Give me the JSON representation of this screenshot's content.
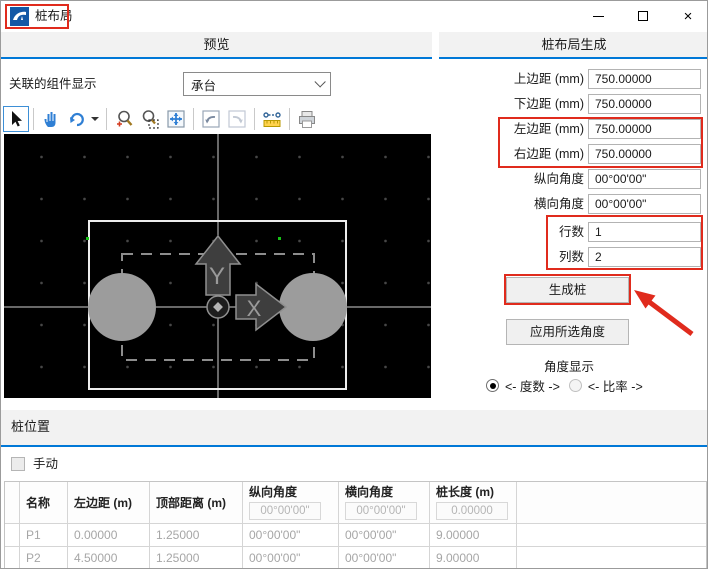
{
  "window": {
    "title": "桩布局",
    "controls": {
      "minimize": "minimize",
      "maximize": "maximize",
      "close_glyph": "×"
    }
  },
  "colors": {
    "accent_blue": "#0078d7",
    "annotation_red": "#e02b1d",
    "pile_gray": "#9c9c9c"
  },
  "preview_panel": {
    "header": "预览",
    "component_label": "关联的组件显示",
    "component_value": "承台",
    "toolbar_icons": [
      "select-cursor",
      "pan-hand",
      "rotate-view",
      "zoom-in",
      "zoom-window",
      "fit-view",
      "prev-view",
      "next-view",
      "measure",
      "print"
    ],
    "canvas": {
      "x_axis_label": "X",
      "y_axis_label": "Y"
    }
  },
  "generation_panel": {
    "header": "桩布局生成",
    "fields": [
      {
        "label": "上边距 (mm)",
        "value": "750.00000"
      },
      {
        "label": "下边距 (mm)",
        "value": "750.00000"
      },
      {
        "label": "左边距 (mm)",
        "value": "750.00000"
      },
      {
        "label": "右边距 (mm)",
        "value": "750.00000"
      },
      {
        "label": "纵向角度",
        "value": "00°00'00\""
      },
      {
        "label": "横向角度",
        "value": "00°00'00\""
      },
      {
        "label": "行数",
        "value": "1"
      },
      {
        "label": "列数",
        "value": "2"
      }
    ],
    "generate_button": "生成桩",
    "apply_angle_button": "应用所选角度",
    "angle_display_label": "角度显示",
    "angle_options": [
      {
        "label": "<- 度数 ->",
        "selected": true
      },
      {
        "label": "<- 比率 ->",
        "selected": false
      }
    ]
  },
  "pile_position_panel": {
    "header": "桩位置",
    "manual_label": "手动",
    "table": {
      "columns": [
        "名称",
        "左边距 (m)",
        "顶部距离 (m)",
        "纵向角度",
        "横向角度",
        "桩长度 (m)"
      ],
      "header_inputs": {
        "vertical_angle": "00°00'00\"",
        "horizontal_angle": "00°00'00\"",
        "pile_length": "0.00000"
      },
      "rows": [
        {
          "name": "P1",
          "left_margin": "0.00000",
          "top_distance": "1.25000",
          "vertical_angle": "00°00'00\"",
          "horizontal_angle": "00°00'00\"",
          "pile_length": "9.00000"
        },
        {
          "name": "P2",
          "left_margin": "4.50000",
          "top_distance": "1.25000",
          "vertical_angle": "00°00'00\"",
          "horizontal_angle": "00°00'00\"",
          "pile_length": "9.00000"
        }
      ]
    }
  }
}
